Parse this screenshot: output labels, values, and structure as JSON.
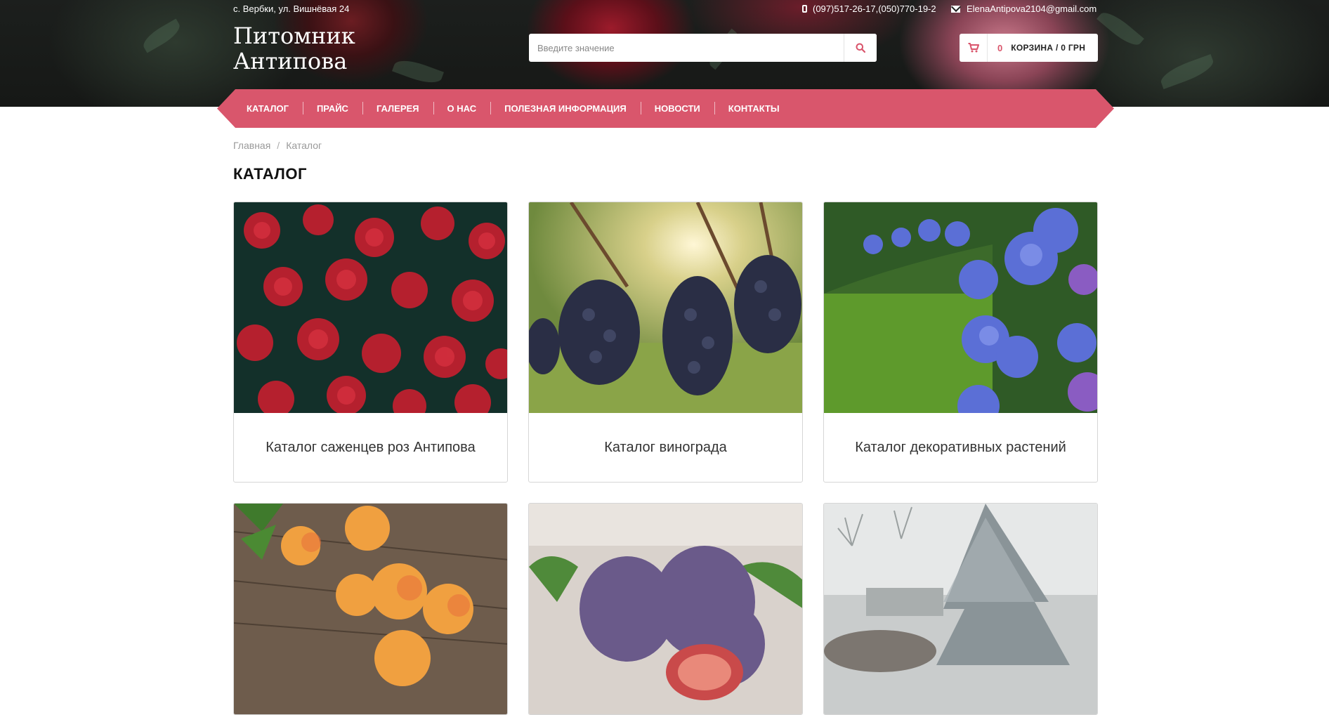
{
  "topbar": {
    "address": "с. Вербки, ул. Вишнёвая 24",
    "phones": "(097)517-26-17,(050)770-19-2",
    "email": "ElenaAntipova2104@gmail.com"
  },
  "logo": {
    "line1": "Питомник",
    "line2": "Антипова"
  },
  "search": {
    "placeholder": "Введите значение"
  },
  "cart": {
    "count": "0",
    "label": "КОРЗИНА / 0 ГРН"
  },
  "nav": [
    "КАТАЛОГ",
    "ПРАЙС",
    "ГАЛЕРЕЯ",
    "О НАС",
    "ПОЛЕЗНАЯ ИНФОРМАЦИЯ",
    "НОВОСТИ",
    "КОНТАКТЫ"
  ],
  "breadcrumb": {
    "home": "Главная",
    "separator": "/",
    "current": "Каталог"
  },
  "page_title": "КАТАЛОГ",
  "catalog": [
    {
      "title": "Каталог саженцев роз Антипова",
      "image": "red roses"
    },
    {
      "title": "Каталог винограда",
      "image": "grape clusters"
    },
    {
      "title": "Каталог декоративных растений",
      "image": "blue hydrangeas"
    },
    {
      "title": "",
      "image": "apricots"
    },
    {
      "title": "",
      "image": "figs"
    },
    {
      "title": "",
      "image": "blue spruce"
    }
  ],
  "colors": {
    "accent": "#d9566c",
    "header_bg": "#1a1c1a"
  }
}
